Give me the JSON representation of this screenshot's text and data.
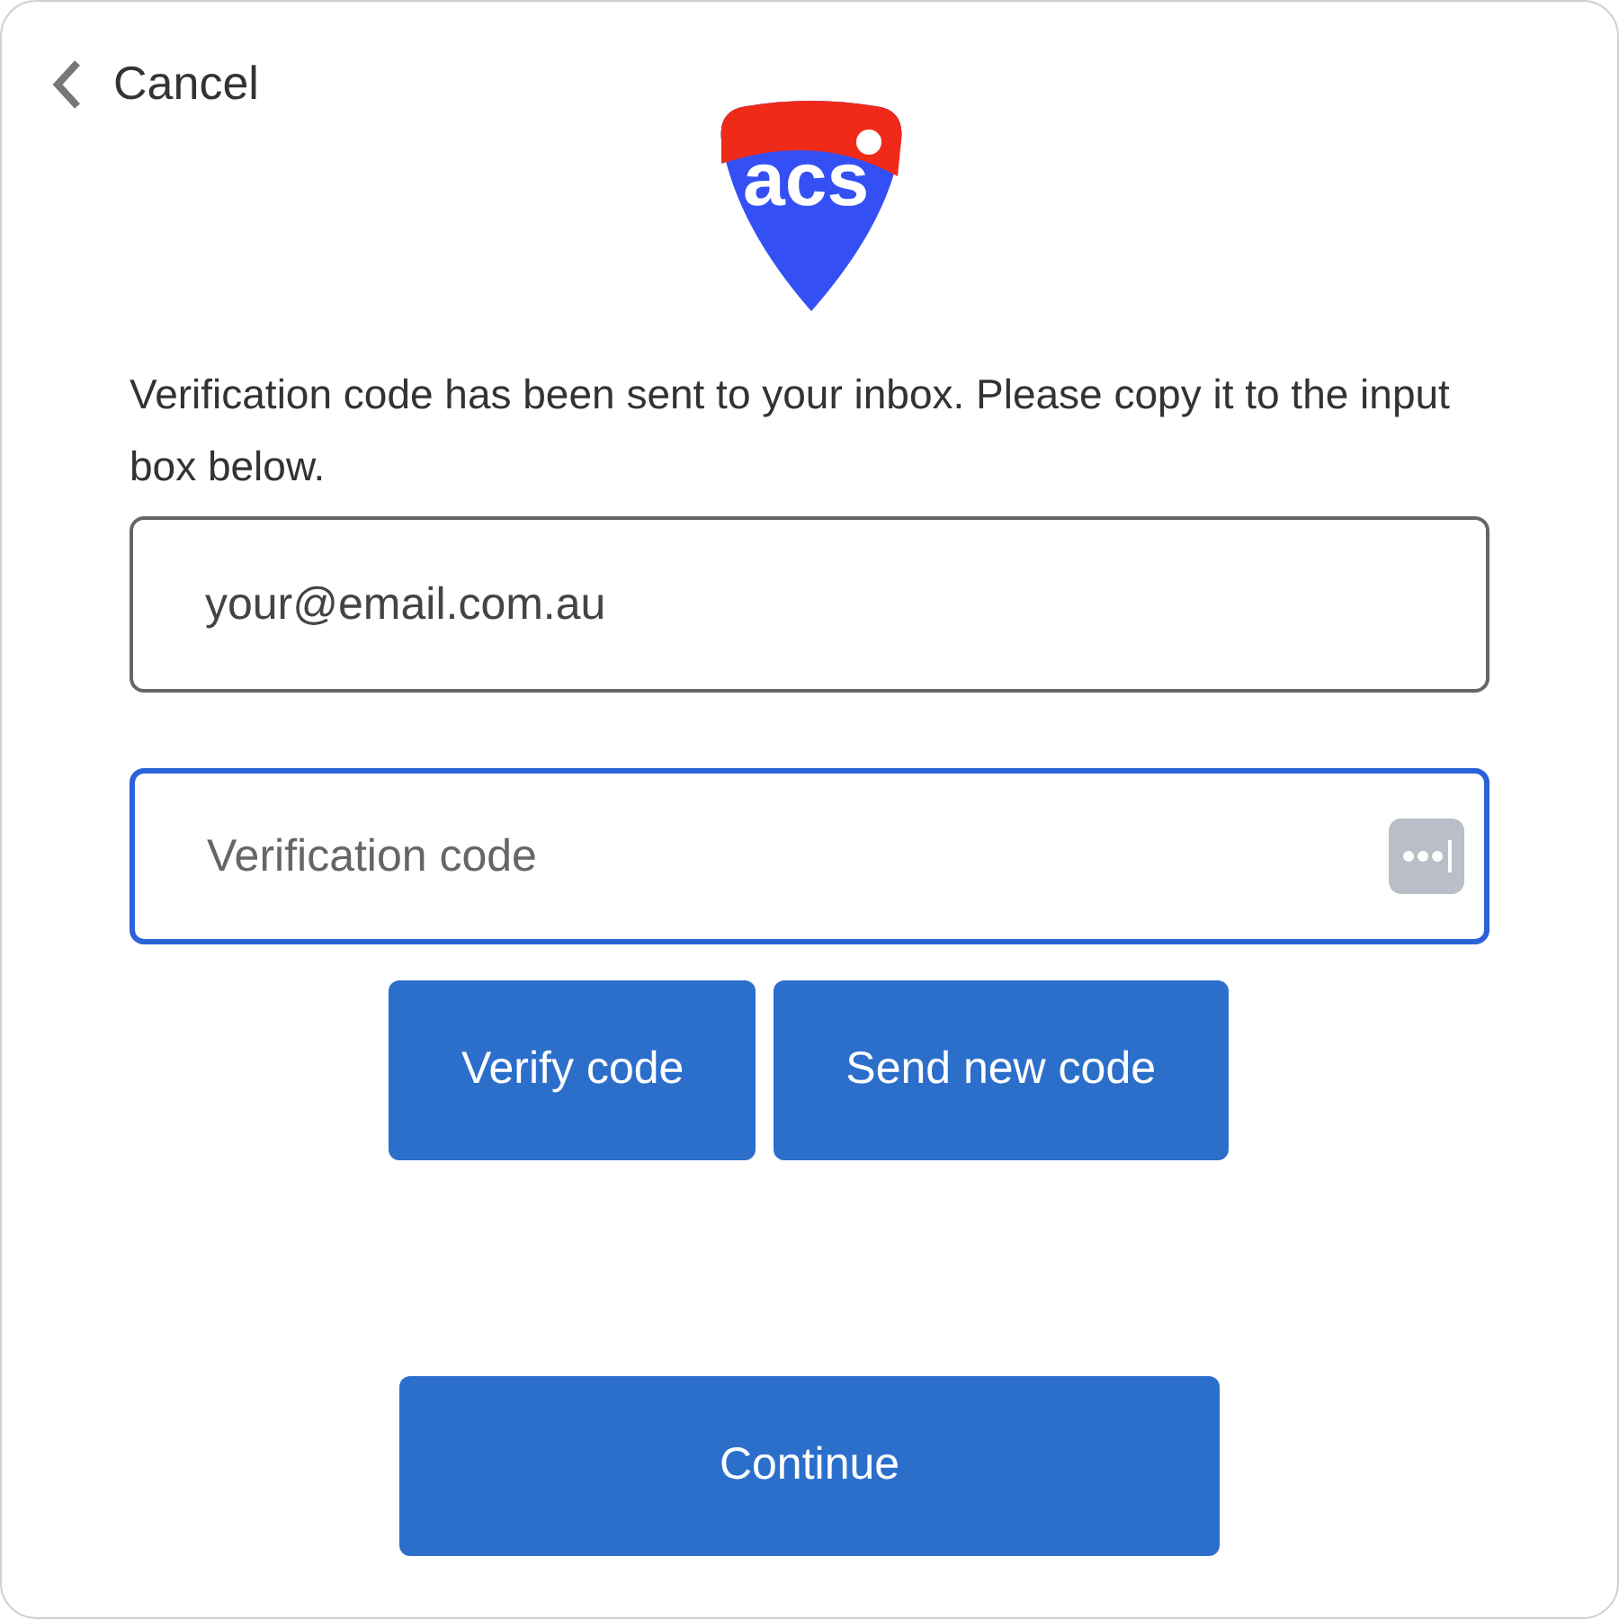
{
  "cancel": {
    "label": "Cancel"
  },
  "logo": {
    "text": "acs"
  },
  "message": "Verification code has been sent to your inbox. Please copy it to the input box below.",
  "fields": [
    {
      "value": "your@email.com.au",
      "focused": false,
      "kind": "email"
    },
    {
      "placeholder": "Verification code",
      "focused": true,
      "kind": "code"
    }
  ],
  "buttons": [
    {
      "label": "Verify code"
    },
    {
      "label": "Send new code"
    }
  ],
  "continue": {
    "label": "Continue"
  }
}
